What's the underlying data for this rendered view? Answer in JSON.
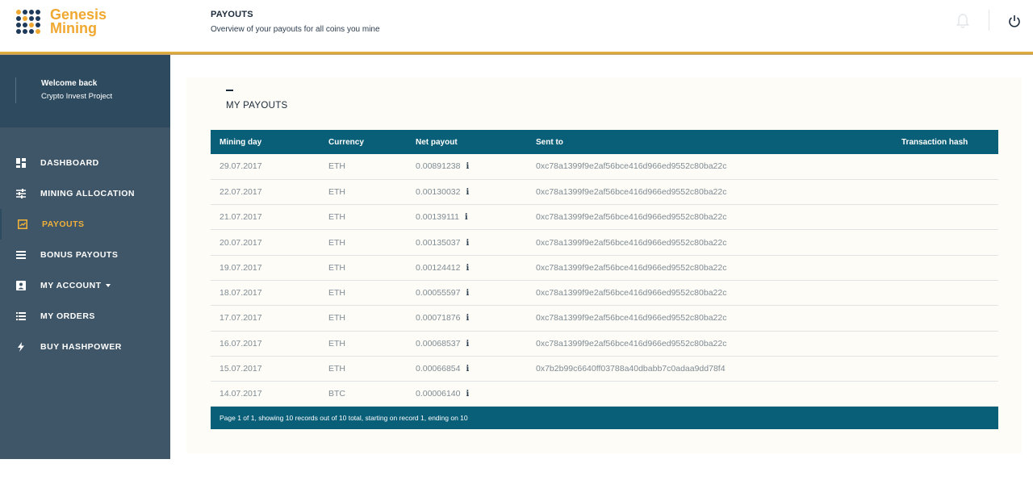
{
  "header": {
    "logo_line1": "Genesis",
    "logo_line2": "Mining",
    "title": "PAYOUTS",
    "subtitle": "Overview of your payouts for all coins you mine",
    "icons": [
      "bell-icon",
      "power-icon"
    ]
  },
  "sidebar": {
    "welcome": "Welcome back",
    "user": "Crypto Invest Project",
    "items": [
      {
        "label": "DASHBOARD",
        "icon": "dashboard-icon"
      },
      {
        "label": "MINING ALLOCATION",
        "icon": "sliders-icon"
      },
      {
        "label": "PAYOUTS",
        "icon": "payouts-icon",
        "active": true
      },
      {
        "label": "BONUS PAYOUTS",
        "icon": "list-icon"
      },
      {
        "label": "MY ACCOUNT",
        "icon": "account-icon"
      },
      {
        "label": "MY ORDERS",
        "icon": "orders-icon"
      },
      {
        "label": "BUY HASHPOWER",
        "icon": "bolt-icon"
      }
    ]
  },
  "main": {
    "section_title": "MY PAYOUTS",
    "columns": [
      "Mining day",
      "Currency",
      "Net payout",
      "Sent to",
      "Transaction hash"
    ],
    "rows": [
      {
        "day": "29.07.2017",
        "currency": "ETH",
        "net": "0.00891238",
        "sent_to": "0xc78a1399f9e2af56bce416d966ed9552c80ba22c",
        "hash": ""
      },
      {
        "day": "22.07.2017",
        "currency": "ETH",
        "net": "0.00130032",
        "sent_to": "0xc78a1399f9e2af56bce416d966ed9552c80ba22c",
        "hash": ""
      },
      {
        "day": "21.07.2017",
        "currency": "ETH",
        "net": "0.00139111",
        "sent_to": "0xc78a1399f9e2af56bce416d966ed9552c80ba22c",
        "hash": ""
      },
      {
        "day": "20.07.2017",
        "currency": "ETH",
        "net": "0.00135037",
        "sent_to": "0xc78a1399f9e2af56bce416d966ed9552c80ba22c",
        "hash": ""
      },
      {
        "day": "19.07.2017",
        "currency": "ETH",
        "net": "0.00124412",
        "sent_to": "0xc78a1399f9e2af56bce416d966ed9552c80ba22c",
        "hash": ""
      },
      {
        "day": "18.07.2017",
        "currency": "ETH",
        "net": "0.00055597",
        "sent_to": "0xc78a1399f9e2af56bce416d966ed9552c80ba22c",
        "hash": ""
      },
      {
        "day": "17.07.2017",
        "currency": "ETH",
        "net": "0.00071876",
        "sent_to": "0xc78a1399f9e2af56bce416d966ed9552c80ba22c",
        "hash": ""
      },
      {
        "day": "16.07.2017",
        "currency": "ETH",
        "net": "0.00068537",
        "sent_to": "0xc78a1399f9e2af56bce416d966ed9552c80ba22c",
        "hash": ""
      },
      {
        "day": "15.07.2017",
        "currency": "ETH",
        "net": "0.00066854",
        "sent_to": "0x7b2b99c6640ff03788a40dbabb7c0adaa9dd78f4",
        "hash": ""
      },
      {
        "day": "14.07.2017",
        "currency": "BTC",
        "net": "0.00006140",
        "sent_to": "",
        "hash": ""
      }
    ],
    "info_glyph": "i",
    "footer": "Page 1 of 1, showing 10 records out of 10 total, starting on record 1, ending on 10"
  },
  "colors": {
    "accent": "#f0b13a",
    "sidebar": "#3f5668",
    "sidebar_header": "#2d4a5f",
    "table_header": "#095e78"
  }
}
